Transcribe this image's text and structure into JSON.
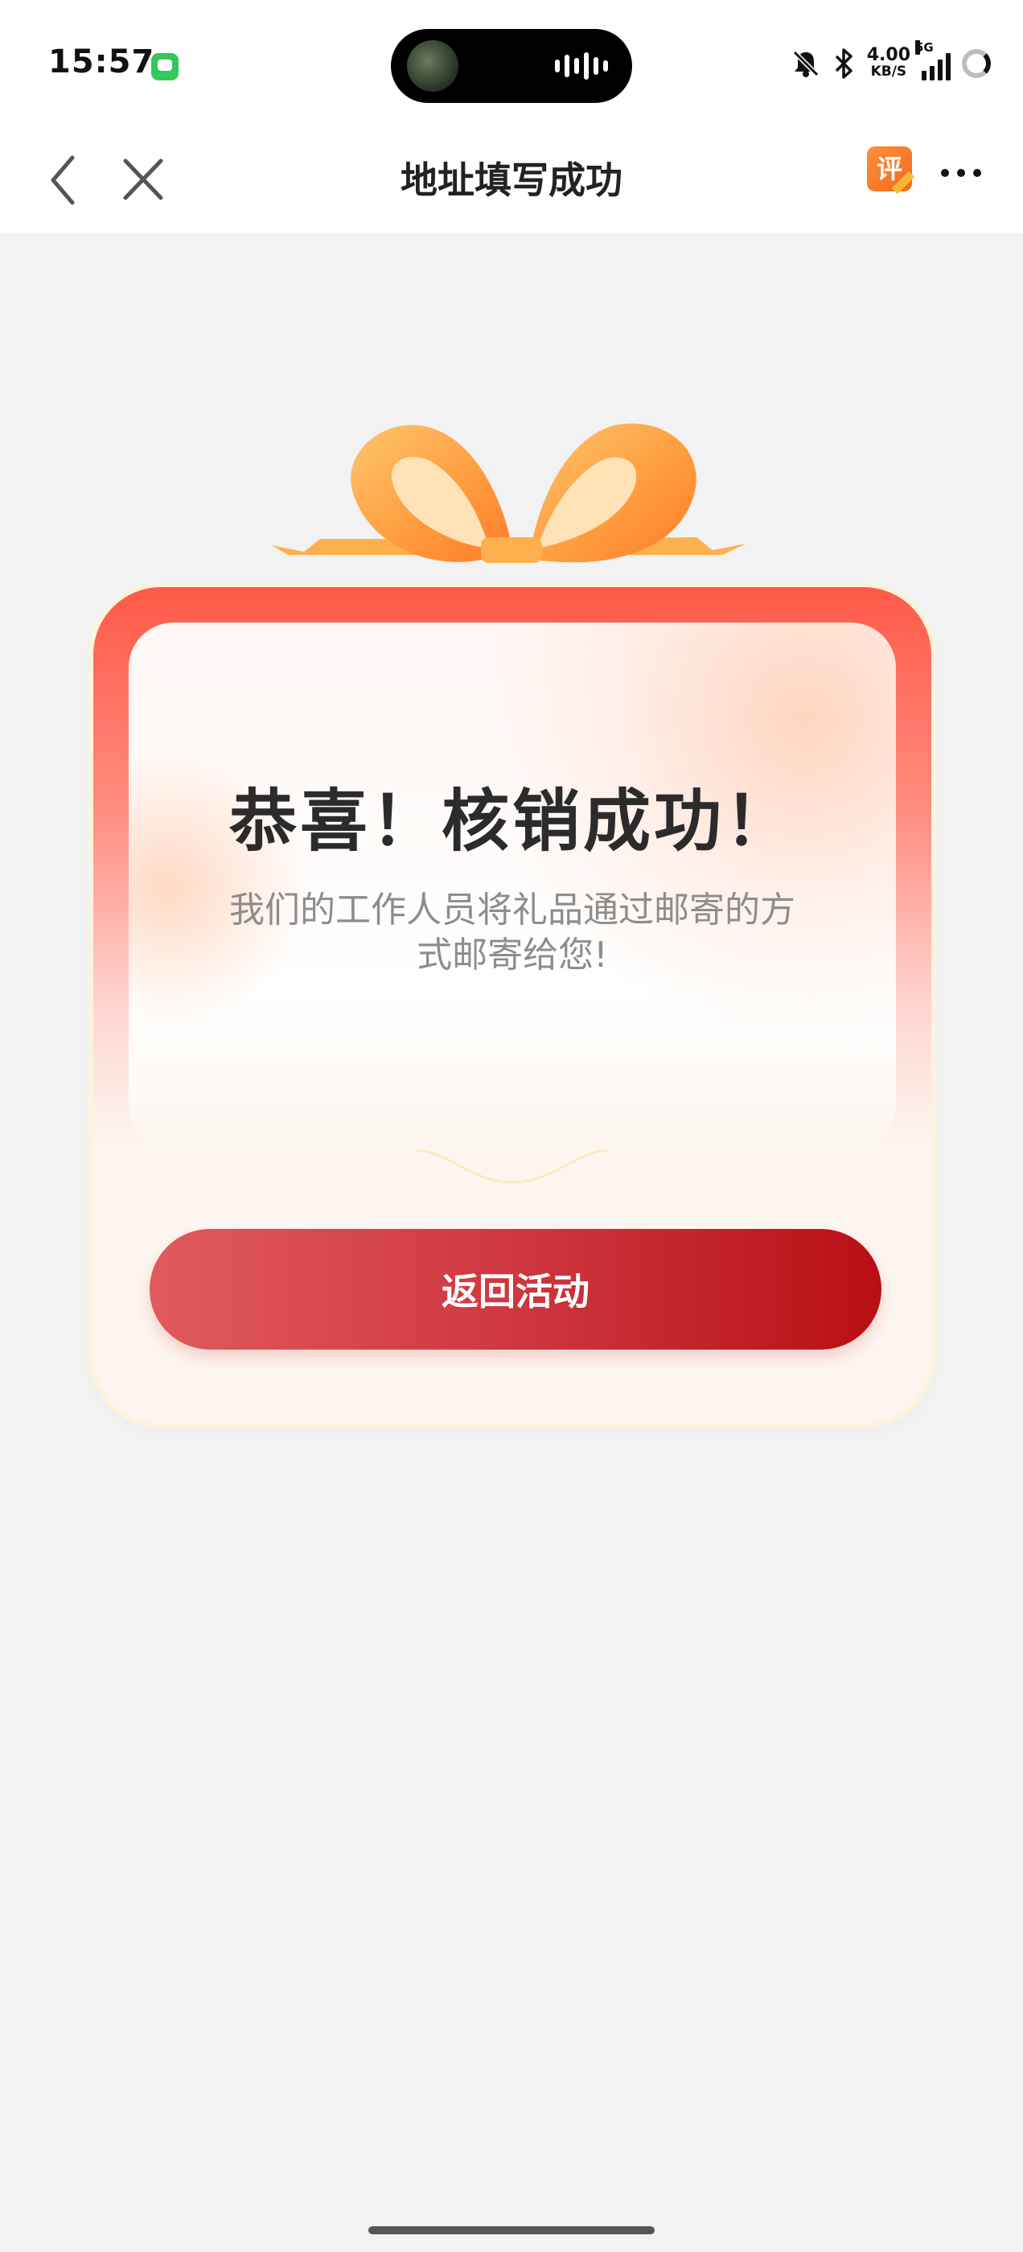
{
  "status_bar": {
    "time": "15:57",
    "net_speed_value": "4.00",
    "net_speed_unit": "KB/S",
    "network_type": "5G",
    "icons": [
      "message-app-icon",
      "mute-bell-icon",
      "bluetooth-icon",
      "signal-icon",
      "battery-ring-icon"
    ]
  },
  "nav": {
    "title": "地址填写成功",
    "review_badge": "评"
  },
  "card": {
    "title": "恭喜！核销成功！",
    "description": "我们的工作人员将礼品通过邮寄的方式邮寄给您!",
    "button_label": "返回活动"
  },
  "colors": {
    "accent_red": "#cf3740",
    "card_top": "#ff5a48",
    "ribbon_orange": "#ff9a3c",
    "background": "#f2f2f2"
  }
}
